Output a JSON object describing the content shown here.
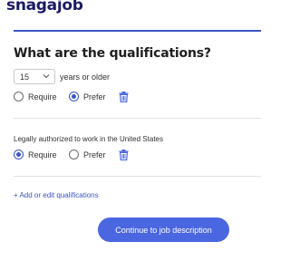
{
  "brand": {
    "logo_text": "snagajob",
    "color": "#1a1a66"
  },
  "accent_color": "#3b56c9",
  "heading": "What are the qualifications?",
  "qualifications": [
    {
      "age_select": {
        "value": "15",
        "suffix": "years or older"
      },
      "options": [
        {
          "label": "Require",
          "selected": false
        },
        {
          "label": "Prefer",
          "selected": true
        }
      ],
      "delete_icon": "trash-icon"
    },
    {
      "text": "Legally authorized to work in the United States",
      "options": [
        {
          "label": "Require",
          "selected": true
        },
        {
          "label": "Prefer",
          "selected": false
        }
      ],
      "delete_icon": "trash-icon"
    }
  ],
  "add_link": "+ Add or edit qualifications",
  "continue_button": "Continue to job description"
}
